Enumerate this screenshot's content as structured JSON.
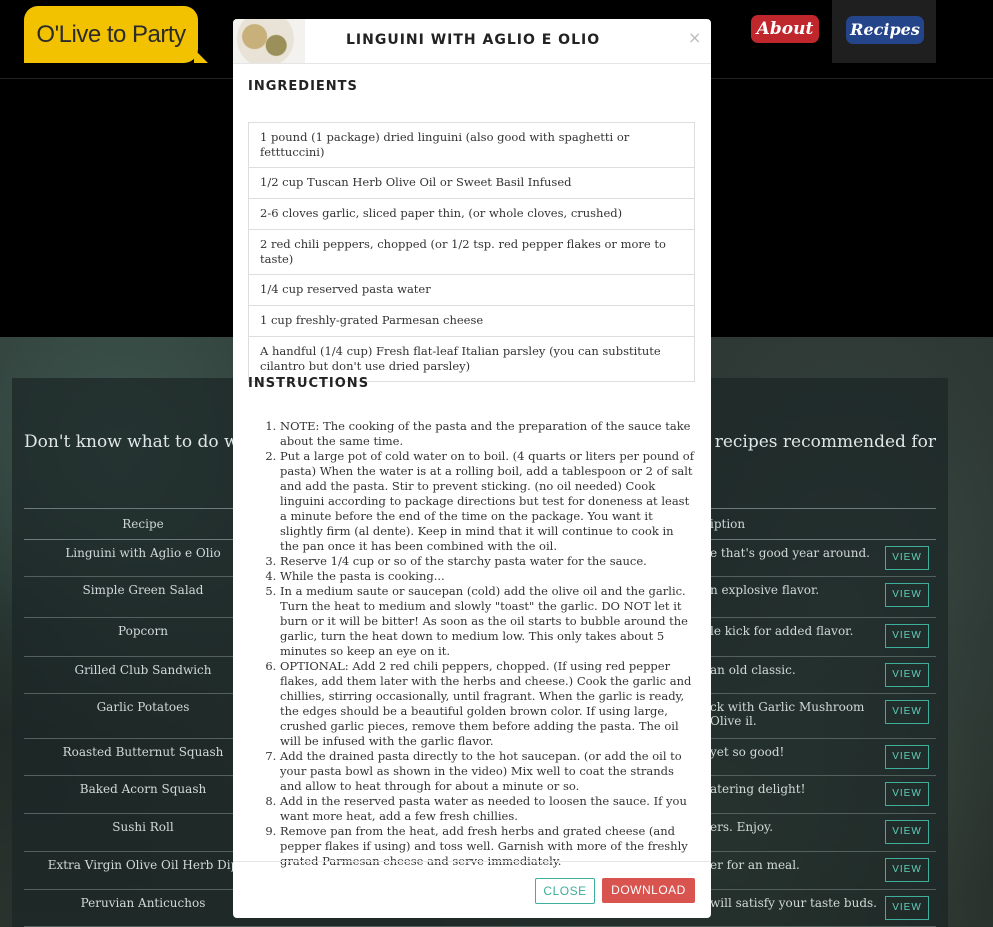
{
  "header": {
    "logo_text": "O'Live to Party",
    "nav": {
      "about": "About",
      "recipes": "Recipes"
    }
  },
  "background": {
    "heading_left": "Don't know what to do with",
    "heading_right": "st of recipes recommended for",
    "table": {
      "col_recipe": "Recipe",
      "col_description": "iption",
      "view_label": "VIEW",
      "rows": [
        {
          "name": "Linguini with Aglio e Olio",
          "desc": "e that's good year around."
        },
        {
          "name": "Simple Green Salad",
          "desc": "n explosive flavor."
        },
        {
          "name": "Popcorn",
          "desc": "le kick for added flavor."
        },
        {
          "name": "Grilled Club Sandwich",
          "desc": "an old classic."
        },
        {
          "name": "Garlic Potatoes",
          "desc": "ck with Garlic Mushroom Olive il."
        },
        {
          "name": "Roasted Butternut Squash",
          "desc": "yet so good!"
        },
        {
          "name": "Baked Acorn Squash",
          "desc": "atering delight!"
        },
        {
          "name": "Sushi Roll",
          "desc": "ers. Enjoy."
        },
        {
          "name": "Extra Virgin Olive Oil Herb Dip",
          "desc": "er for an meal."
        },
        {
          "name": "Peruvian Anticuchos",
          "desc": "will satisfy your taste buds."
        }
      ]
    }
  },
  "modal": {
    "title": "LINGUINI WITH AGLIO E OLIO",
    "close_symbol": "×",
    "ingredients_heading": "INGREDIENTS",
    "ingredients": [
      "1 pound (1 package) dried linguini (also good with spaghetti or fetttuccini)",
      "1/2 cup Tuscan Herb Olive Oil or Sweet Basil Infused",
      "2-6 cloves garlic, sliced paper thin, (or whole cloves, crushed)",
      "2 red chili peppers, chopped (or 1/2 tsp. red pepper flakes or more to taste)",
      "1/4 cup reserved pasta water",
      "1 cup freshly-grated Parmesan cheese",
      "A handful (1/4 cup) Fresh flat-leaf Italian parsley (you can substitute cilantro but don't use dried parsley)"
    ],
    "instructions_heading": "INSTRUCTIONS",
    "instructions": [
      "NOTE: The cooking of the pasta and the preparation of the sauce take about the same time.",
      "Put a large pot of cold water on to boil. (4 quarts or liters per pound of pasta) When the water is at a rolling boil, add a tablespoon or 2 of salt and add the pasta. Stir to prevent sticking. (no oil needed) Cook linguini according to package directions but test for doneness at least a minute before the end of the time on the package. You want it slightly firm (al dente). Keep in mind that it will continue to cook in the pan once it has been combined with the oil.",
      "Reserve 1/4 cup or so of the starchy pasta water for the sauce.",
      "While the pasta is cooking...",
      "In a medium saute or saucepan (cold) add the olive oil and the garlic. Turn the heat to medium and slowly \"toast\" the garlic. DO NOT let it burn or it will be bitter! As soon as the oil starts to bubble around the garlic, turn the heat down to medium low. This only takes about 5 minutes so keep an eye on it.",
      "OPTIONAL: Add 2 red chili peppers, chopped. (If using red pepper flakes, add them later with the herbs and cheese.) Cook the garlic and chillies, stirring occasionally, until fragrant. When the garlic is ready, the edges should be a beautiful golden brown color. If using large, crushed garlic pieces, remove them before adding the pasta. The oil will be infused with the garlic flavor.",
      "Add the drained pasta directly to the hot saucepan. (or add the oil to your pasta bowl as shown in the video) Mix well to coat the strands and allow to heat through for about a minute or so.",
      "Add in the reserved pasta water as needed to loosen the sauce. If you want more heat, add a few fresh chillies.",
      "Remove pan from the heat, add fresh herbs and grated cheese (and pepper flakes if using) and toss well. Garnish with more of the freshly grated Parmesan cheese and serve immediately."
    ],
    "footer": {
      "close_label": "CLOSE",
      "download_label": "DOWNLOAD"
    }
  },
  "colors": {
    "logo": "#f2c200",
    "about_button": "#c0272d",
    "recipes_button": "#24458a",
    "accent_teal": "#3fae9a",
    "download_button": "#d9534f"
  }
}
